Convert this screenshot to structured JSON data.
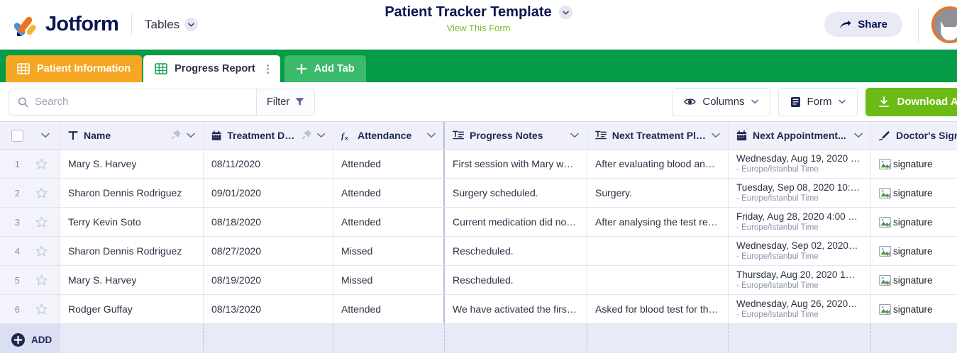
{
  "brand": {
    "name": "Jotform",
    "logo_colors": [
      "#4a90e2",
      "#f2711c",
      "#f5b335"
    ],
    "accent_green": "#6cba15",
    "header_green": "#069b46"
  },
  "header": {
    "product_menu": "Tables",
    "form_title": "Patient Tracker Template",
    "view_form_link": "View This Form",
    "share_label": "Share"
  },
  "tabs": [
    {
      "label": "Patient Information",
      "active": false,
      "color": "#f5a623"
    },
    {
      "label": "Progress Report",
      "active": true,
      "color": "#ffffff"
    },
    {
      "label": "Add Tab",
      "active": false,
      "color": "#3aba6b"
    }
  ],
  "toolbar": {
    "search_placeholder": "Search",
    "search_value": "",
    "filter_label": "Filter",
    "columns_label": "Columns",
    "form_label": "Form",
    "download_label": "Download All"
  },
  "table": {
    "columns": [
      {
        "key": "name",
        "label": "Name",
        "icon": "text-icon",
        "pinned": true
      },
      {
        "key": "date",
        "label": "Treatment Date",
        "icon": "calendar-icon",
        "pinned": true
      },
      {
        "key": "att",
        "label": "Attendance",
        "icon": "formula-icon",
        "pinned": false
      },
      {
        "key": "notes",
        "label": "Progress Notes",
        "icon": "long-text-icon",
        "pinned": false
      },
      {
        "key": "plan",
        "label": "Next Treatment Plan",
        "icon": "long-text-icon",
        "pinned": false
      },
      {
        "key": "appt",
        "label": "Next Appointment...",
        "icon": "calendar-icon",
        "pinned": false
      },
      {
        "key": "sign",
        "label": "Doctor's Sign",
        "icon": "pen-icon",
        "pinned": false
      }
    ],
    "rows": [
      {
        "num": "1",
        "name": "Mary S. Harvey",
        "date": "08/11/2020",
        "att": "Attended",
        "notes": "First session with Mary wa…",
        "plan": "After evaluating blood ana…",
        "appt_main": "Wednesday, Aug 19, 2020 …",
        "appt_sub": "- Europe/Istanbul Time",
        "sign_alt": "signature"
      },
      {
        "num": "2",
        "name": "Sharon Dennis Rodriguez",
        "date": "09/01/2020",
        "att": "Attended",
        "notes": "Surgery scheduled.",
        "plan": "Surgery.",
        "appt_main": "Tuesday, Sep 08, 2020 10:…",
        "appt_sub": "- Europe/Istanbul Time",
        "sign_alt": "signature"
      },
      {
        "num": "3",
        "name": "Terry Kevin Soto",
        "date": "08/18/2020",
        "att": "Attended",
        "notes": "Current medication did no…",
        "plan": "After analysing the test re…",
        "appt_main": "Friday, Aug 28, 2020 4:00 …",
        "appt_sub": "- Europe/Istanbul Time",
        "sign_alt": "signature"
      },
      {
        "num": "4",
        "name": "Sharon Dennis Rodriguez",
        "date": "08/27/2020",
        "att": "Missed",
        "notes": "Rescheduled.",
        "plan": "",
        "appt_main": "Wednesday, Sep 02, 2020…",
        "appt_sub": "- Europe/Istanbul Time",
        "sign_alt": "signature"
      },
      {
        "num": "5",
        "name": "Mary S. Harvey",
        "date": "08/19/2020",
        "att": "Missed",
        "notes": "Rescheduled.",
        "plan": "",
        "appt_main": "Thursday, Aug 20, 2020 1…",
        "appt_sub": "- Europe/Istanbul Time",
        "sign_alt": "signature"
      },
      {
        "num": "6",
        "name": "Rodger Guffay",
        "date": "08/13/2020",
        "att": "Attended",
        "notes": "We have activated the firs…",
        "plan": "Asked for blood test for th…",
        "appt_main": "Wednesday, Aug 26, 2020…",
        "appt_sub": "- Europe/Istanbul Time",
        "sign_alt": "signature"
      }
    ],
    "add_row_label": "ADD"
  }
}
